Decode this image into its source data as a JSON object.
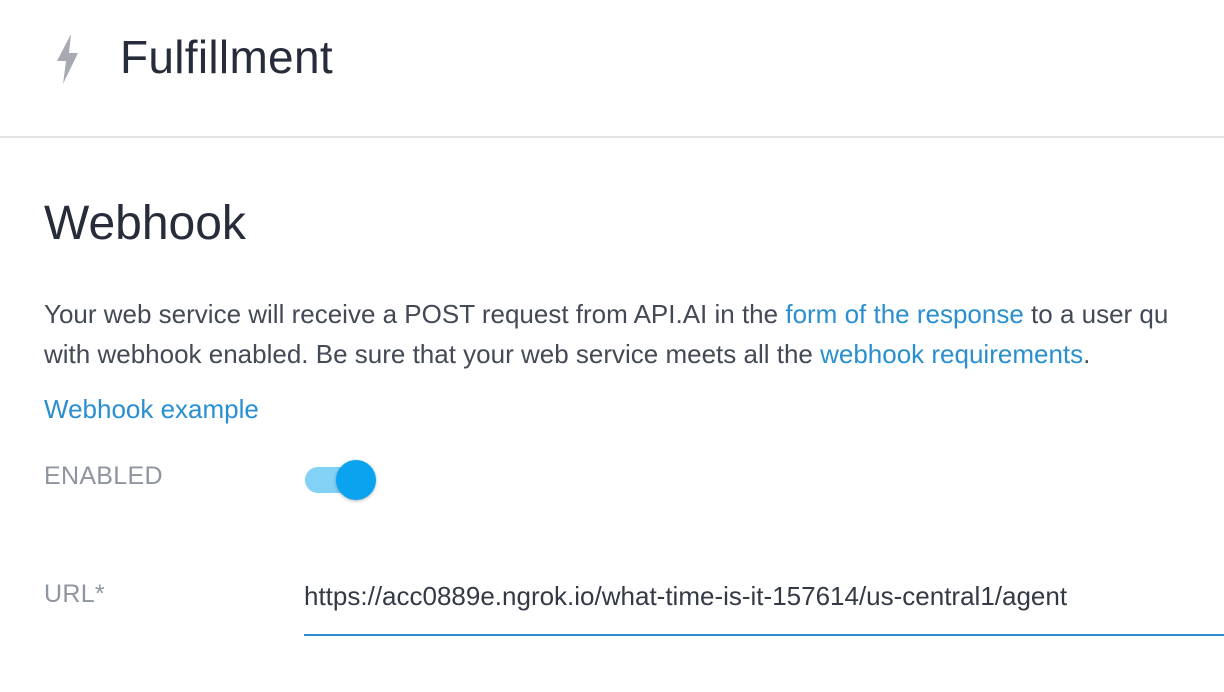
{
  "header": {
    "icon": "lightning-bolt-icon",
    "title": "Fulfillment"
  },
  "webhook": {
    "title": "Webhook",
    "description": {
      "line1_before": "Your web service will receive a POST request from API.AI in the ",
      "line1_link": "form of the response",
      "line1_after": " to a user qu",
      "line2_before": "with webhook enabled. Be sure that your web service meets all the ",
      "line2_link": "webhook requirements",
      "line2_after": "."
    },
    "example_link": "Webhook example",
    "enabled_label": "ENABLED",
    "enabled": true,
    "url_label": "URL*",
    "url_value": "https://acc0889e.ngrok.io/what-time-is-it-157614/us-central1/agent"
  },
  "colors": {
    "link": "#2a8fd0",
    "toggle_track": "#82d2f6",
    "toggle_knob": "#0aa3ef",
    "title_text": "#262c3a",
    "label_text": "#8f959e"
  }
}
